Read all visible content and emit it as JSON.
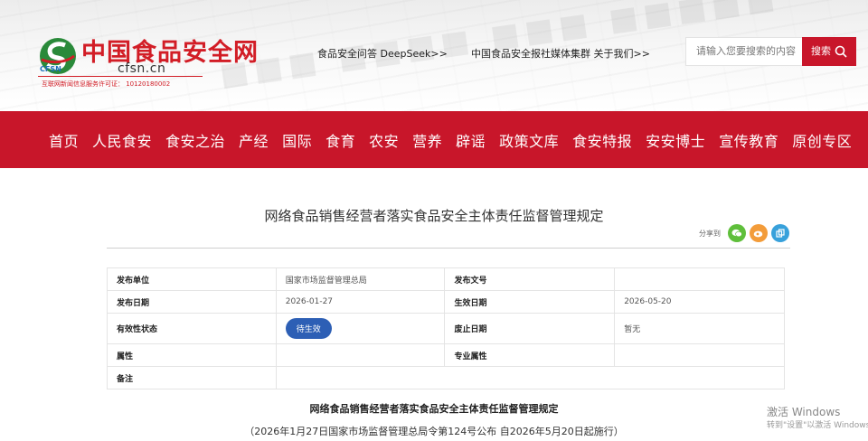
{
  "site": {
    "logo_cn": "中国食品安全网",
    "logo_en": "cfsn.cn",
    "logo_abbr": "CFSN",
    "license": "互联网新闻信息服务许可证： 10120180002"
  },
  "header": {
    "link_deepseek": "食品安全问答 DeepSeek>>",
    "link_media": "中国食品安全报社媒体集群 关于我们>>",
    "search_placeholder": "请输入您要搜索的内容",
    "search_button": "搜索"
  },
  "nav": [
    "首页",
    "人民食安",
    "食安之治",
    "产经",
    "国际",
    "食育",
    "农安",
    "营养",
    "辟谣",
    "政策文库",
    "食安特报",
    "安安博士",
    "宣传教育",
    "原创专区"
  ],
  "article": {
    "title": "网络食品销售经营者落实食品安全主体责任监督管理规定",
    "share_label": "分享到"
  },
  "info_rows": [
    {
      "l1": "发布单位",
      "v1": "国家市场监督管理总局",
      "l2": "发布文号",
      "v2": ""
    },
    {
      "l1": "发布日期",
      "v1": "2026-01-27",
      "l2": "生效日期",
      "v2": "2026-05-20"
    },
    {
      "l1": "有效性状态",
      "v1": "待生效",
      "l2": "废止日期",
      "v2": "暂无"
    },
    {
      "l1": "属性",
      "v1": "",
      "l2": "专业属性",
      "v2": ""
    },
    {
      "l1": "备注",
      "v1": ""
    }
  ],
  "document": {
    "title": "网络食品销售经营者落实食品安全主体责任监督管理规定",
    "subtitle": "（2026年1月27日国家市场监督管理总局令第124号公布 自2026年5月20日起施行）"
  },
  "watermark": {
    "line1": "激活 Windows",
    "line2": "转到\"设置\"以激活 Windows。"
  },
  "colors": {
    "brand_red": "#c8162a",
    "badge_blue": "#2d5fb5",
    "wechat_green": "#5fbf3b",
    "weibo_orange": "#f39c3a",
    "copy_blue": "#38a1db"
  }
}
